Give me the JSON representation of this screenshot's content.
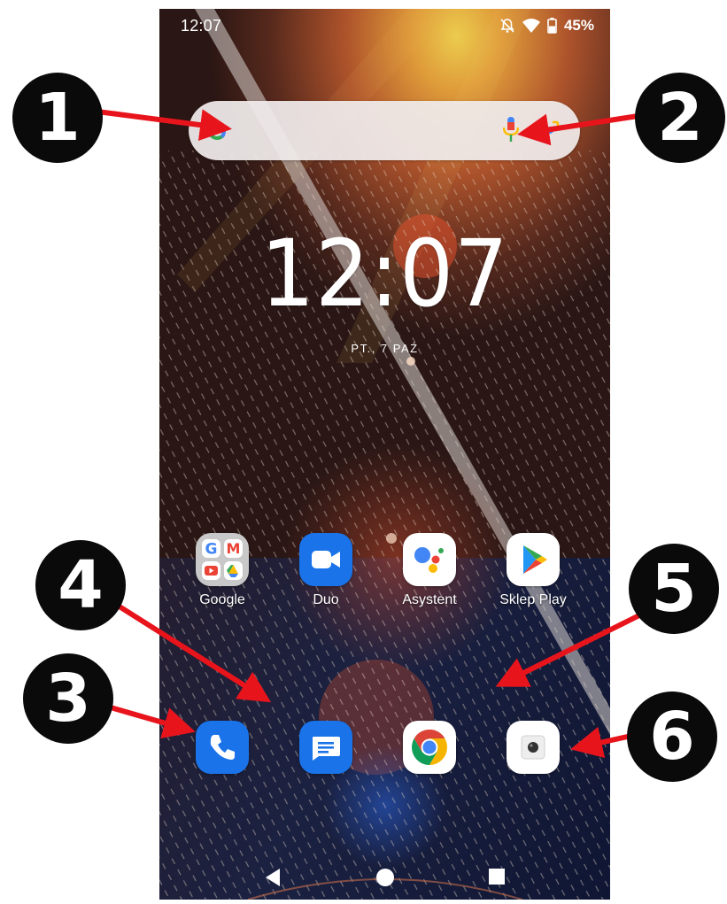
{
  "status_bar": {
    "time": "12:07",
    "battery_percent": "45%",
    "icons": [
      "notifications-off-icon",
      "wifi-icon",
      "battery-icon"
    ]
  },
  "search_bar": {
    "placeholder": "",
    "icons": [
      "google-logo-icon",
      "microphone-icon",
      "google-lens-icon"
    ]
  },
  "clock_widget": {
    "time": "12:07",
    "date": "PT., 7 PAŹ"
  },
  "apps": [
    {
      "label": "Google",
      "icon": "google-folder-icon"
    },
    {
      "label": "Duo",
      "icon": "duo-icon"
    },
    {
      "label": "Asystent",
      "icon": "assistant-icon"
    },
    {
      "label": "Sklep Play",
      "icon": "play-store-icon"
    }
  ],
  "dock": [
    {
      "icon": "phone-icon"
    },
    {
      "icon": "messages-icon"
    },
    {
      "icon": "chrome-icon"
    },
    {
      "icon": "camera-icon"
    }
  ],
  "nav_bar": {
    "icons": [
      "back-icon",
      "home-icon",
      "recents-icon"
    ]
  },
  "callouts": [
    "1",
    "2",
    "3",
    "4",
    "5",
    "6"
  ],
  "colors": {
    "callout_background": "#0a0a0a",
    "arrow": "#e8141c",
    "app_blue": "#1a73e8"
  }
}
